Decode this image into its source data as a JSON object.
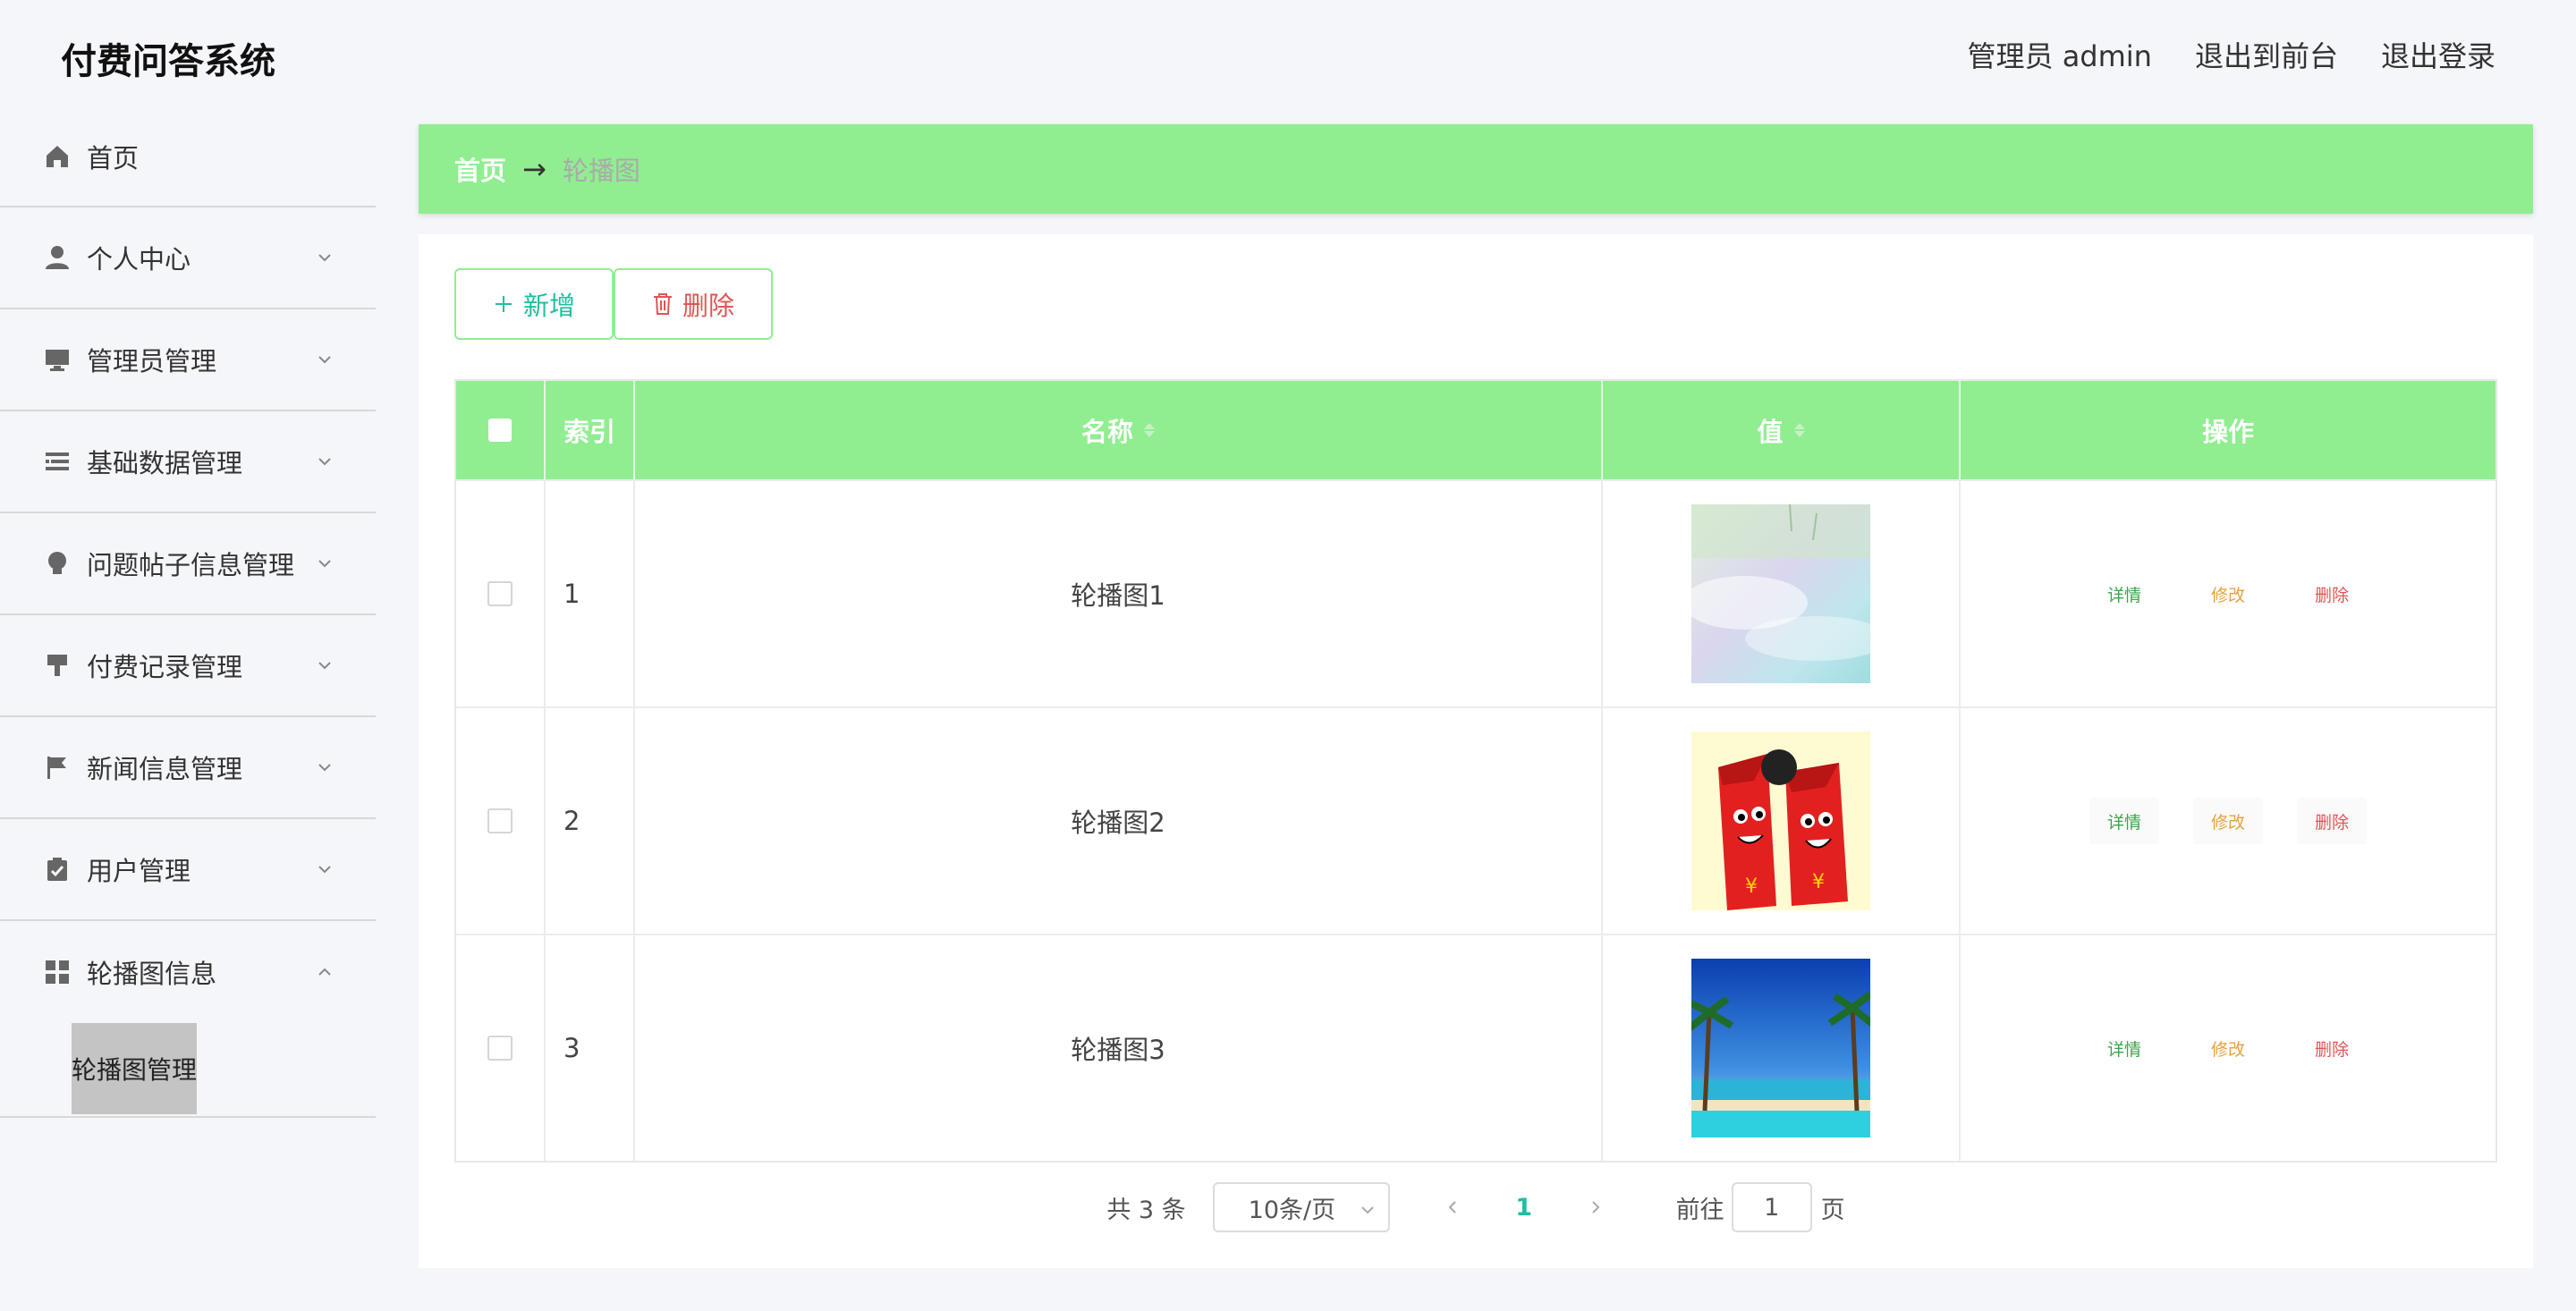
{
  "app": {
    "title": "付费问答系统"
  },
  "topbar": {
    "user": "管理员 admin",
    "to_front": "退出到前台",
    "logout": "退出登录"
  },
  "sidebar": {
    "items": [
      {
        "label": "首页",
        "icon": "home-icon"
      },
      {
        "label": "个人中心",
        "icon": "user-icon"
      },
      {
        "label": "管理员管理",
        "icon": "monitor-icon"
      },
      {
        "label": "基础数据管理",
        "icon": "list-icon"
      },
      {
        "label": "问题帖子信息管理",
        "icon": "bulb-icon"
      },
      {
        "label": "付费记录管理",
        "icon": "brush-icon"
      },
      {
        "label": "新闻信息管理",
        "icon": "flag-icon"
      },
      {
        "label": "用户管理",
        "icon": "clipboard-icon"
      },
      {
        "label": "轮播图信息",
        "icon": "grid-icon"
      }
    ],
    "active_sub": "轮播图管理"
  },
  "breadcrumb": {
    "home": "首页",
    "sep": "→",
    "current": "轮播图"
  },
  "toolbar": {
    "add": "新增",
    "delete": "删除"
  },
  "table": {
    "headers": {
      "index": "索引",
      "name": "名称",
      "value": "值",
      "ops": "操作"
    },
    "rows": [
      {
        "index": "1",
        "name": "轮播图1",
        "image": "pastel-abstract"
      },
      {
        "index": "2",
        "name": "轮播图2",
        "image": "red-envelope-cartoon"
      },
      {
        "index": "3",
        "name": "轮播图3",
        "image": "beach-palms"
      }
    ],
    "ops": {
      "detail": "详情",
      "edit": "修改",
      "remove": "删除"
    }
  },
  "pagination": {
    "total": "共 3 条",
    "page_size": "10条/页",
    "current": "1",
    "goto": "前往",
    "goto_value": "1",
    "unit": "页"
  },
  "colors": {
    "accent": "#90ee90",
    "teal": "#1fbfa0",
    "danger": "#e05555",
    "warning": "#e6a23c"
  }
}
